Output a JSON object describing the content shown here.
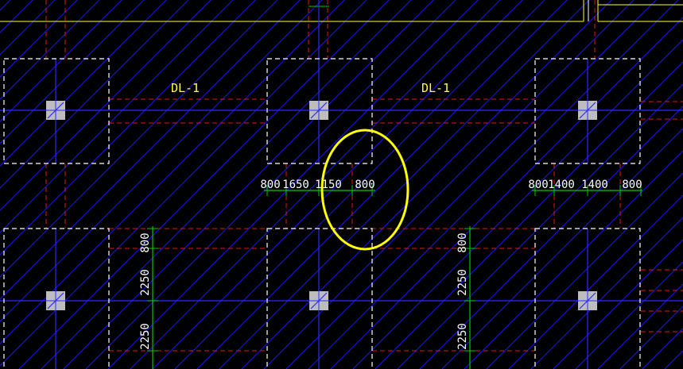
{
  "colors": {
    "background": "#000000",
    "hatch": "#1a1ad6",
    "axis": "#2a2aff",
    "dashed_red": "#e01818",
    "footing_outline": "#ffffff",
    "column": "#bdbdbd",
    "dimension_line": "#00c800",
    "dimension_text": "#ffffff",
    "beam_label": "#ffff3c",
    "highlight_ellipse": "#ffff00",
    "top_wall": "#ffff3c"
  },
  "beam_labels": {
    "left": "DL-1",
    "right": "DL-1"
  },
  "dimensions": {
    "row_left": [
      "800",
      "1650",
      "1150",
      "800"
    ],
    "row_right": [
      "800",
      "1400",
      "1400",
      "800"
    ],
    "col_left": [
      "800",
      "2250",
      "2250"
    ],
    "col_right": [
      "800",
      "2250",
      "2250"
    ]
  },
  "icons": {
    "column_marker": "column-marker-icon",
    "highlight": "highlight-ellipse-icon"
  }
}
